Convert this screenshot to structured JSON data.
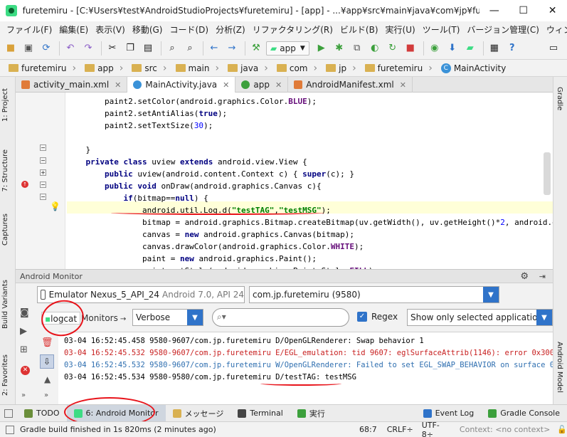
{
  "window": {
    "title": "furetemiru - [C:¥Users¥test¥AndroidStudioProjects¥furetemiru] - [app] - ...¥app¥src¥main¥java¥com¥jp¥furetemiru¥M...",
    "minimize": "—",
    "maximize": "☐",
    "close": "✕"
  },
  "menu": [
    "ファイル(F)",
    "編集(E)",
    "表示(V)",
    "移動(G)",
    "コード(D)",
    "分析(Z)",
    "リファクタリング(R)",
    "ビルド(B)",
    "実行(U)",
    "ツール(T)",
    "バージョン管理(C)",
    "ウィンドウ(W)",
    "ヘルプ(H)"
  ],
  "toolbar": {
    "run_config": "app"
  },
  "breadcrumb": [
    "furetemiru",
    "app",
    "src",
    "main",
    "java",
    "com",
    "jp",
    "furetemiru",
    "MainActivity"
  ],
  "left_tabs": [
    "1: Project",
    "7: Structure",
    "Captures",
    "Build Variants",
    "2: Favorites"
  ],
  "right_tabs": [
    "Gradle",
    "Android Model"
  ],
  "editor_tabs": [
    {
      "label": "activity_main.xml",
      "active": false
    },
    {
      "label": "MainActivity.java",
      "active": true
    },
    {
      "label": "app",
      "active": false
    },
    {
      "label": "AndroidManifest.xml",
      "active": false
    }
  ],
  "code_lines": [
    "        paint2.setColor(android.graphics.Color.BLUE);",
    "        paint2.setAntiAlias(true);",
    "        paint2.setTextSize(30);",
    "",
    "    }",
    "    private class uview extends android.view.View {",
    "        public uview(android.content.Context c) { super(c); }",
    "        public void onDraw(android.graphics.Canvas c){",
    "            if(bitmap==null) {",
    "                android.util.Log.d(\"testTAG\",\"testMSG\");",
    "                bitmap = android.graphics.Bitmap.createBitmap(uv.getWidth(), uv.getHeight()*2, android.graphics.Bitmap",
    "                canvas = new android.graphics.Canvas(bitmap);",
    "                canvas.drawColor(android.graphics.Color.WHITE);",
    "                paint = new android.graphics.Paint();",
    "                paint.setStyle(android.graphics.Paint.Style.FILL);"
  ],
  "monitor": {
    "title": "Android Monitor",
    "device": "Emulator Nexus_5_API_24",
    "device_detail": "Android 7.0, API 24",
    "process": "com.jp.furetemiru",
    "process_pid": "(9580)",
    "tab_logcat": "logcat",
    "tab_monitors": "Monitors",
    "level": "Verbose",
    "search_placeholder": "",
    "regex_label": "Regex",
    "filter": "Show only selected application",
    "log_lines": [
      "03-04 16:52:45.458 9580-9607/com.jp.furetemiru D/OpenGLRenderer: Swap behavior 1",
      "03-04 16:52:45.532 9580-9607/com.jp.furetemiru E/EGL_emulation: tid 9607: eglSurfaceAttrib(1146): error 0x3009 (EGL",
      "03-04 16:52:45.532 9580-9607/com.jp.furetemiru W/OpenGLRenderer: Failed to set EGL_SWAP_BEHAVIOR on surface 0x8cc9",
      "03-04 16:52:45.534 9580-9580/com.jp.furetemiru D/testTAG: testMSG"
    ]
  },
  "tool_windows": [
    {
      "label": "TODO",
      "color": "#6a8e3a"
    },
    {
      "label": "6: Android Monitor",
      "color": "#3ddc84"
    },
    {
      "label": "メッセージ",
      "color": "#d9b152"
    },
    {
      "label": "Terminal",
      "color": "#444444"
    },
    {
      "label": "実行",
      "color": "#3ca03c"
    }
  ],
  "tool_windows_right": [
    {
      "label": "Event Log"
    },
    {
      "label": "Gradle Console"
    }
  ],
  "status": {
    "message": "Gradle build finished in 1s 820ms (2 minutes ago)",
    "position": "68:7",
    "line_sep": "CRLF÷",
    "encoding": "UTF-8÷",
    "context": "Context: <no context>"
  },
  "colors": {
    "annotation": "#e8141b",
    "accent": "#2f73c9",
    "android": "#3ddc84"
  }
}
